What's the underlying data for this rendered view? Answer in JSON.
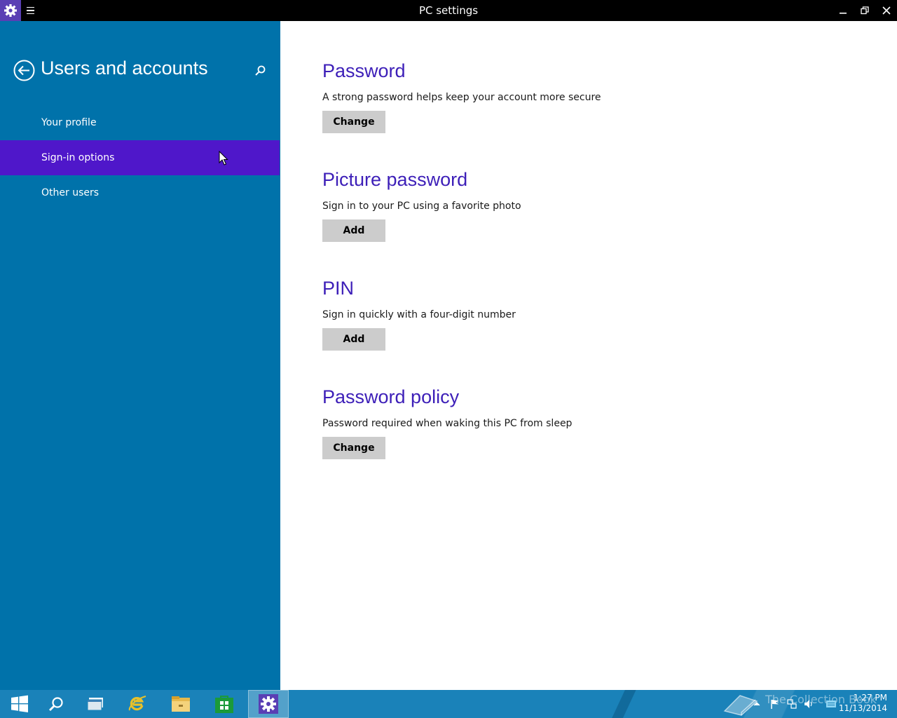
{
  "window": {
    "title": "PC settings",
    "app_icon": "gear-icon",
    "controls": [
      "minimize-icon",
      "restore-icon",
      "close-icon"
    ]
  },
  "sidebar": {
    "title": "Users and accounts",
    "items": [
      {
        "label": "Your profile",
        "selected": false
      },
      {
        "label": "Sign-in options",
        "selected": true
      },
      {
        "label": "Other users",
        "selected": false
      }
    ]
  },
  "sections": [
    {
      "heading": "Password",
      "description": "A strong password helps keep your account more secure",
      "button": "Change"
    },
    {
      "heading": "Picture password",
      "description": "Sign in to your PC using a favorite photo",
      "button": "Add"
    },
    {
      "heading": "PIN",
      "description": "Sign in quickly with a four-digit number",
      "button": "Add"
    },
    {
      "heading": "Password policy",
      "description": "Password required when waking this PC from sleep",
      "button": "Change"
    }
  ],
  "taskbar": {
    "apps": [
      "start-icon",
      "search-icon",
      "task-view-icon",
      "internet-explorer-icon",
      "file-explorer-icon",
      "store-icon",
      "pc-settings-icon"
    ],
    "watermark": "The Collection Book",
    "time": "1:27 PM",
    "date": "11/13/2014"
  },
  "colors": {
    "sidebar_bg": "#0072aa",
    "selected_bg": "#4f17ca",
    "heading": "#3d1fb8",
    "button_bg": "#cccccc",
    "taskbar_bg": "#1a82b9"
  }
}
